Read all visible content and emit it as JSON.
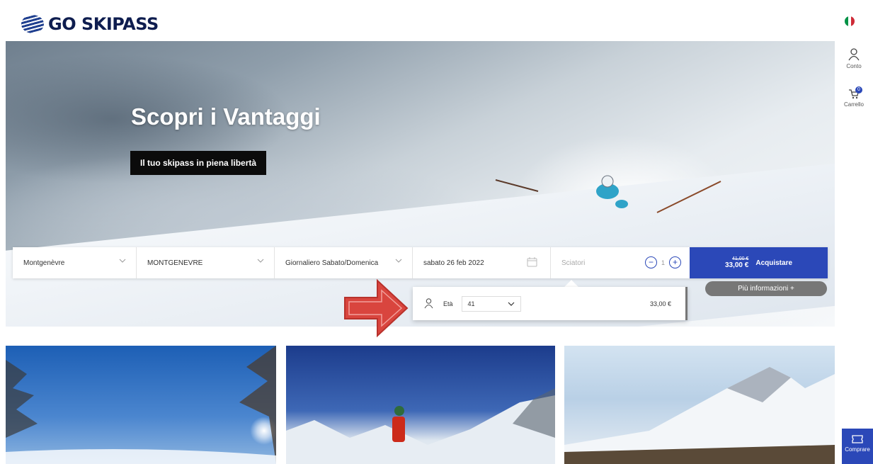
{
  "header": {
    "brand": "GO SKIPASS",
    "language_flag": "italian-flag-icon",
    "account_label": "Conto",
    "cart_label": "Carrello",
    "cart_count": "0",
    "buy_tab_label": "Comprare"
  },
  "hero": {
    "title": "Scopri i Vantaggi",
    "tagline": "Il tuo skipass in piena libertà"
  },
  "search": {
    "resort": "Montgenèvre",
    "area": "MONTGENEVRE",
    "pass_type": "Giornaliero Sabato/Domenica",
    "date": "sabato 26 feb 2022",
    "skiers_placeholder": "Sciatori",
    "skiers_count": "1",
    "minus_label": "−",
    "plus_label": "+",
    "old_price": "41,00 €",
    "new_price": "33,00 €",
    "buy_label": "Acquistare",
    "more_info": "Più informazioni +"
  },
  "skier_popup": {
    "age_label": "Età",
    "age_value": "41",
    "price": "33,00 €"
  },
  "colors": {
    "brand_blue": "#2b48b8",
    "annotation_arrow": "#d9453e"
  }
}
